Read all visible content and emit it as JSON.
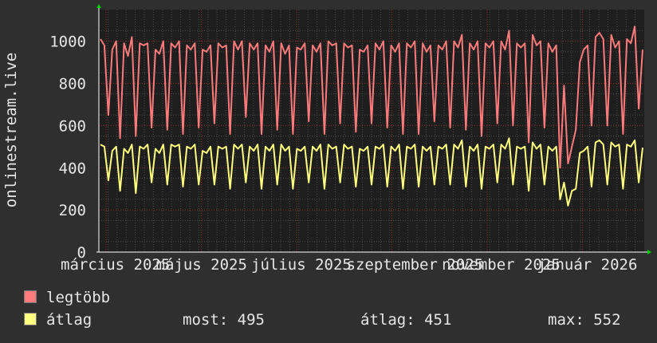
{
  "chart_data": {
    "type": "line",
    "ylabel": "onlinestream.live",
    "ylim": [
      0,
      1150
    ],
    "yticks": [
      0,
      200,
      400,
      600,
      800,
      1000
    ],
    "xticks": [
      "március 2025",
      "május 2025",
      "július 2025",
      "szeptember 2025",
      "november 2025",
      "január 2026"
    ],
    "grid": true,
    "background": "#1e1e1e",
    "series": [
      {
        "name": "legtöbb",
        "color": "#ff7a7a",
        "values": [
          1010,
          980,
          650,
          960,
          1000,
          540,
          990,
          930,
          1020,
          550,
          990,
          980,
          990,
          590,
          960,
          940,
          1000,
          580,
          990,
          970,
          1000,
          560,
          980,
          960,
          990,
          590,
          960,
          950,
          980,
          610,
          990,
          970,
          980,
          560,
          1000,
          960,
          1000,
          640,
          990,
          960,
          990,
          560,
          980,
          950,
          1000,
          580,
          990,
          940,
          980,
          560,
          970,
          960,
          990,
          620,
          980,
          950,
          990,
          560,
          1000,
          980,
          990,
          610,
          990,
          970,
          980,
          570,
          960,
          950,
          980,
          610,
          990,
          960,
          1000,
          590,
          980,
          950,
          990,
          560,
          990,
          970,
          1000,
          560,
          990,
          950,
          980,
          620,
          980,
          960,
          1000,
          590,
          1000,
          970,
          1030,
          580,
          990,
          960,
          1000,
          550,
          990,
          970,
          1000,
          610,
          1000,
          960,
          1050,
          600,
          990,
          970,
          990,
          520,
          1030,
          980,
          1000,
          590,
          990,
          950,
          980,
          400,
          790,
          420,
          500,
          580,
          900,
          960,
          980,
          600,
          1020,
          1040,
          1010,
          600,
          1030,
          970,
          1000,
          560,
          1010,
          990,
          1070,
          680,
          960
        ]
      },
      {
        "name": "átlag",
        "color": "#ffff80",
        "values": [
          510,
          500,
          340,
          480,
          500,
          290,
          490,
          470,
          510,
          280,
          500,
          490,
          510,
          330,
          490,
          470,
          510,
          320,
          510,
          500,
          510,
          310,
          500,
          490,
          510,
          320,
          480,
          470,
          500,
          320,
          500,
          490,
          500,
          300,
          510,
          490,
          510,
          330,
          500,
          480,
          510,
          300,
          500,
          480,
          510,
          320,
          510,
          480,
          500,
          300,
          490,
          480,
          500,
          330,
          500,
          480,
          510,
          300,
          510,
          490,
          500,
          330,
          510,
          490,
          500,
          310,
          490,
          480,
          500,
          320,
          500,
          490,
          510,
          310,
          500,
          480,
          510,
          300,
          500,
          490,
          510,
          310,
          500,
          480,
          500,
          320,
          500,
          490,
          510,
          320,
          510,
          490,
          530,
          310,
          500,
          480,
          510,
          300,
          500,
          490,
          510,
          330,
          510,
          490,
          540,
          320,
          500,
          490,
          500,
          290,
          520,
          490,
          510,
          320,
          500,
          480,
          500,
          250,
          330,
          220,
          290,
          300,
          470,
          480,
          500,
          310,
          520,
          530,
          510,
          320,
          520,
          500,
          510,
          300,
          510,
          500,
          530,
          330,
          495
        ]
      }
    ],
    "legend": {
      "max_label": "legtöbb",
      "avg_label": "átlag",
      "now": "most: 495",
      "avg": "átlag: 451",
      "max": "max: 552"
    }
  }
}
